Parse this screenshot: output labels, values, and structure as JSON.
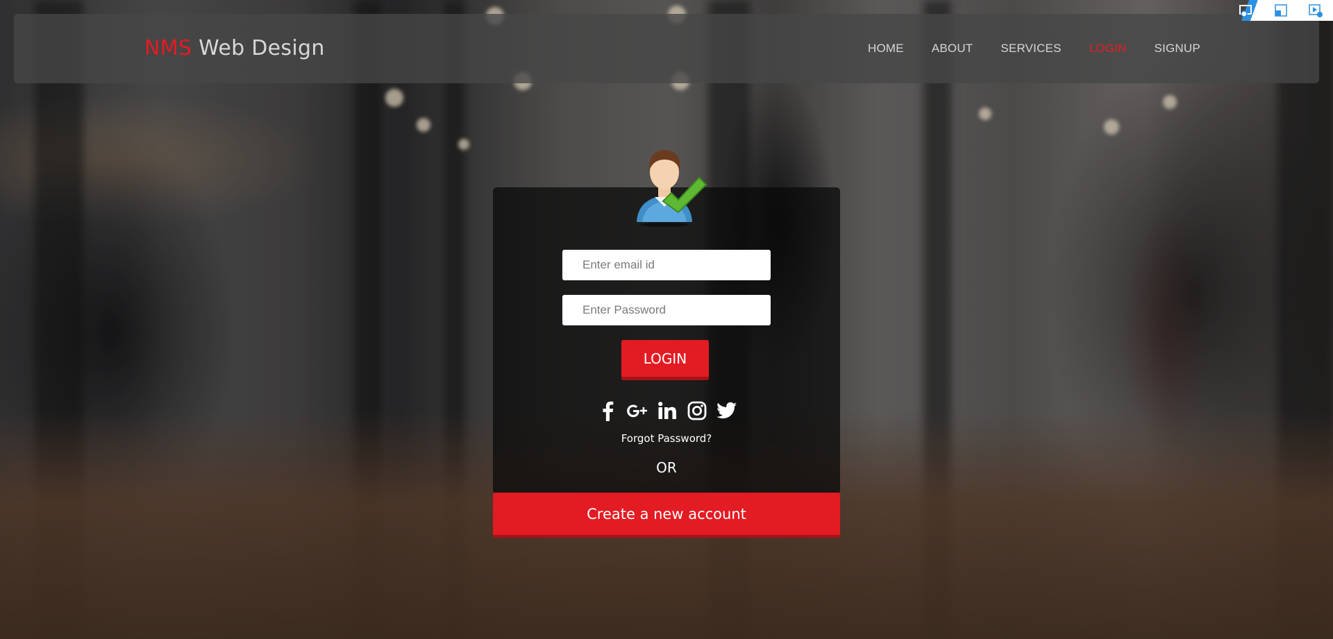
{
  "navbar": {
    "brand_accent": "NMS",
    "brand_rest": " Web Design",
    "links": [
      {
        "label": "HOME",
        "active": false
      },
      {
        "label": "ABOUT",
        "active": false
      },
      {
        "label": "SERVICES",
        "active": false
      },
      {
        "label": "LOGIN",
        "active": true
      },
      {
        "label": "SIGNUP",
        "active": false
      }
    ]
  },
  "login_form": {
    "avatar_icon": "user-check-icon",
    "email_placeholder": "Enter email id",
    "password_placeholder": "Enter Password",
    "login_label": "LOGIN",
    "social_icons": [
      "facebook-icon",
      "google-plus-icon",
      "linkedin-icon",
      "instagram-icon",
      "twitter-icon"
    ],
    "forgot_label": "Forgot Password?",
    "or_label": "OR",
    "create_account_label": "Create a new account"
  },
  "system_icons": [
    "screen-capture-icon",
    "window-restore-icon",
    "video-record-icon"
  ],
  "colors": {
    "accent": "#e31b23",
    "accent_dark": "#a8121a",
    "nav_text": "#d6d6d6",
    "card_bg": "rgba(8,8,8,0.72)"
  }
}
